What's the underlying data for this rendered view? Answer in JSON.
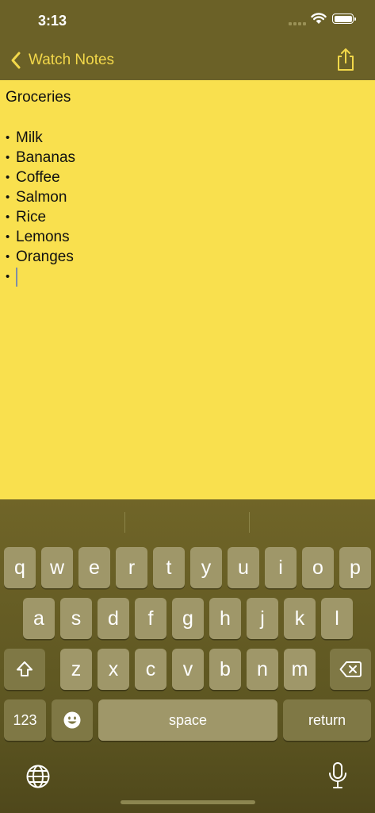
{
  "status_bar": {
    "time": "3:13"
  },
  "nav": {
    "back_label": "Watch Notes"
  },
  "note": {
    "title": "Groceries",
    "bullet": "•",
    "items": [
      "Milk",
      "Bananas",
      "Coffee",
      "Salmon",
      "Rice",
      "Lemons",
      "Oranges"
    ]
  },
  "keyboard": {
    "row1": [
      "q",
      "w",
      "e",
      "r",
      "t",
      "y",
      "u",
      "i",
      "o",
      "p"
    ],
    "row2": [
      "a",
      "s",
      "d",
      "f",
      "g",
      "h",
      "j",
      "k",
      "l"
    ],
    "row3": [
      "z",
      "x",
      "c",
      "v",
      "b",
      "n",
      "m"
    ],
    "numbers_label": "123",
    "space_label": "space",
    "return_label": "return"
  },
  "colors": {
    "accent": "#f3d84a",
    "note_background": "#f9e04e",
    "chrome_background": "#6b6127"
  }
}
